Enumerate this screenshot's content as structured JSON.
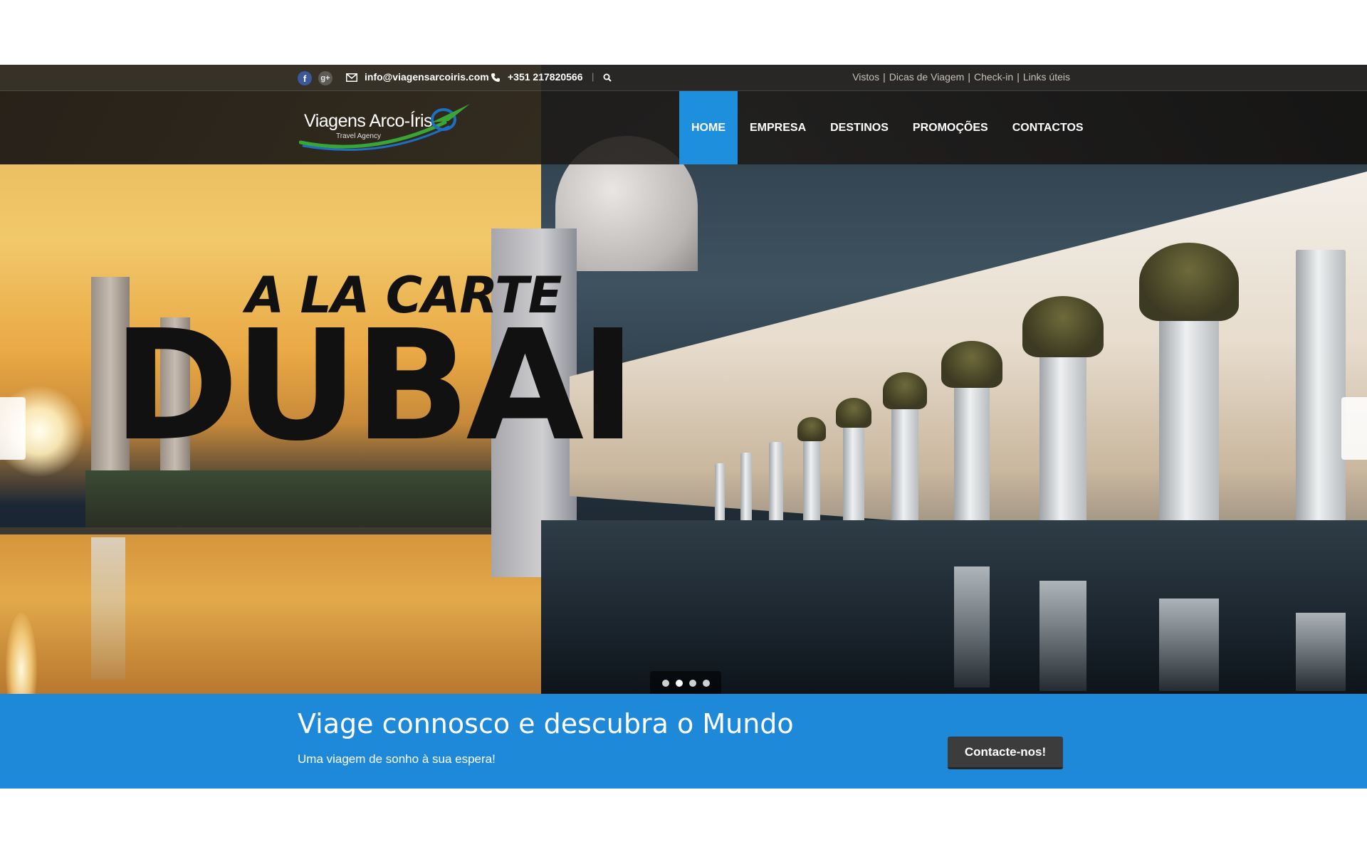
{
  "topbar": {
    "social": {
      "facebook_glyph": "f",
      "googleplus_glyph": "g+"
    },
    "email": "info@viagensarcoiris.com",
    "phone": "+351 217820566",
    "separator": "|",
    "links": [
      {
        "label": "Vistos"
      },
      {
        "label": "Dicas de Viagem"
      },
      {
        "label": "Check-in"
      },
      {
        "label": "Links úteis"
      }
    ],
    "link_separator": "|",
    "icons": [
      "facebook-icon",
      "google-plus-icon",
      "envelope-icon",
      "phone-icon",
      "search-icon"
    ]
  },
  "logo": {
    "title": "Viagens Arco-Íris",
    "subtitle": "Travel Agency",
    "colors": {
      "green": "#3aa537",
      "blue": "#1e6fc2"
    }
  },
  "nav": {
    "items": [
      {
        "label": "HOME",
        "active": true
      },
      {
        "label": "EMPRESA",
        "active": false
      },
      {
        "label": "DESTINOS",
        "active": false
      },
      {
        "label": "PROMOÇÕES",
        "active": false
      },
      {
        "label": "CONTACTOS",
        "active": false
      }
    ],
    "active_color": "#1e8fdc"
  },
  "slider": {
    "kicker": "A LA CARTE",
    "headline": "DUBAI",
    "dots": [
      false,
      true,
      true,
      true
    ],
    "active_dot": 1
  },
  "cta": {
    "title": "Viage connosco e descubra o Mundo",
    "subtitle": "Uma viagem de sonho à sua espera!",
    "button": "Contacte-nos!",
    "band_color": "#1e88d9"
  }
}
